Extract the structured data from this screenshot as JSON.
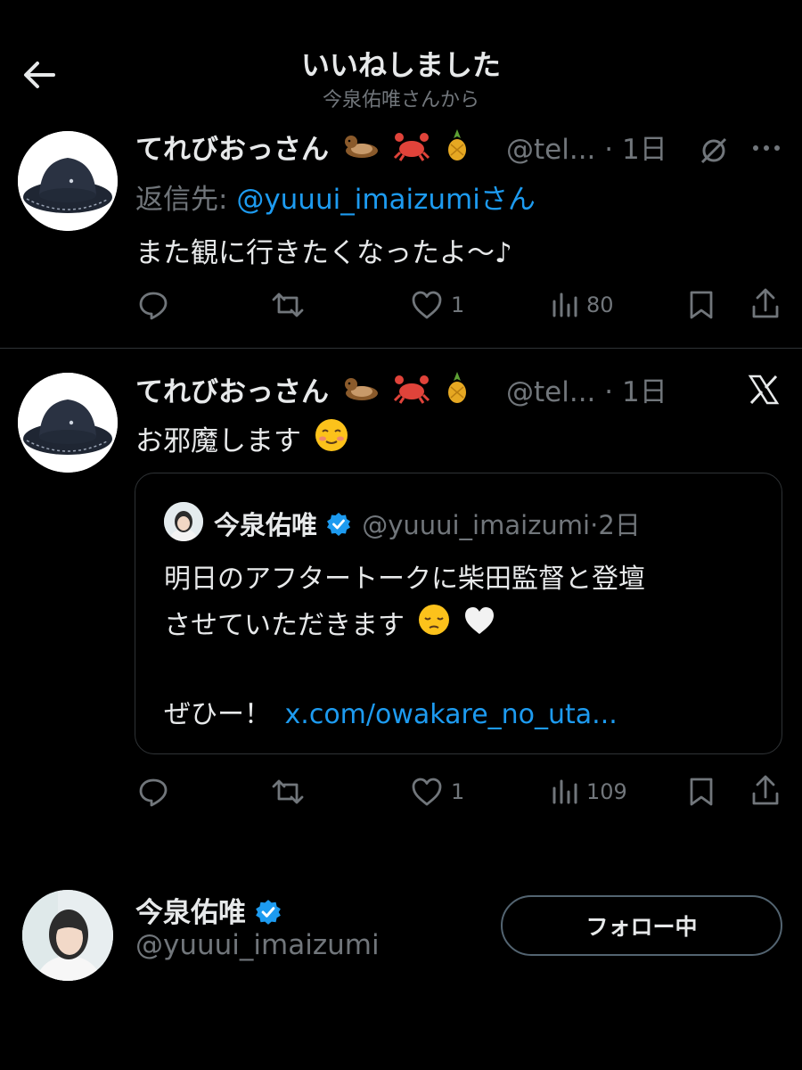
{
  "header": {
    "title": "いいねしました",
    "subtitle": "今泉佑唯さんから"
  },
  "tweets": [
    {
      "display_name": "てれびおっさん",
      "emojis": [
        "otter",
        "crab",
        "pineapple"
      ],
      "handle": "@tel...",
      "dot": "·",
      "time": "1日",
      "reply_prefix": "返信先:",
      "reply_to": "@yuuui_imaizumi",
      "reply_suffix": "さん",
      "text": "また観に行きたくなったよ〜♪",
      "replies": "",
      "retweets": "",
      "likes": "1",
      "views": "80"
    },
    {
      "display_name": "てれびおっさん",
      "emojis": [
        "otter",
        "crab",
        "pineapple"
      ],
      "handle": "@tel...",
      "dot": "·",
      "time": "1日",
      "text": "お邪魔します",
      "replies": "",
      "retweets": "",
      "likes": "1",
      "views": "109",
      "quote": {
        "display_name": "今泉佑唯",
        "handle": "@yuuui_imaizumi",
        "dot": "·",
        "time": "2日",
        "line1": "明日のアフタートークに柴田監督と登壇",
        "line2": "させていただきます",
        "line3": "ぜひー！",
        "link": "x.com/owakare_no_uta..."
      }
    }
  ],
  "profile": {
    "display_name": "今泉佑唯",
    "handle": "@yuuui_imaizumi",
    "follow_label": "フォロー中"
  },
  "colors": {
    "background": "#000000",
    "text": "#e7e9ea",
    "muted": "#71767b",
    "link": "#1d9bf0",
    "verified": "#1d9bf0",
    "divider": "#2f3336"
  }
}
